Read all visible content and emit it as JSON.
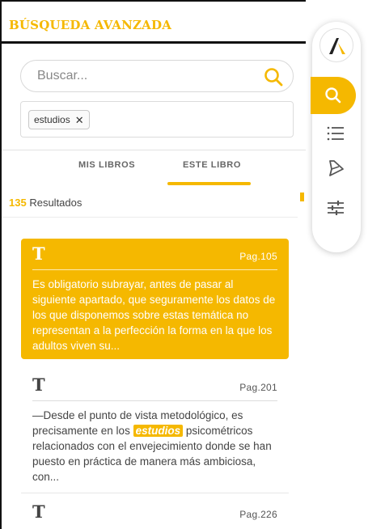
{
  "panel": {
    "title": "BÚSQUEDA AVANZADA",
    "search": {
      "placeholder": "Buscar...",
      "value": ""
    },
    "tags": [
      {
        "label": "estudios"
      }
    ],
    "tabs": [
      {
        "label": "MIS LIBROS",
        "active": false
      },
      {
        "label": "ESTE LIBRO",
        "active": true
      }
    ],
    "results": {
      "count": "135",
      "label": "Resultados"
    },
    "cards": [
      {
        "icon": "T",
        "page": "Pag.105",
        "excerpt": "Es obligatorio subrayar, antes de pasar al siguiente apartado, que seguramente los datos de los que disponemos sobre estas temática no representan a la perfección la forma en la que los adultos viven su...",
        "selected": true
      },
      {
        "icon": "T",
        "page": "Pag.201",
        "excerpt_before": "—Desde el punto de vista metodológico, es precisamente en los",
        "highlight": "estudios",
        "excerpt_after": "psicométricos relacionados con el envejecimiento donde se han puesto en práctica de manera más ambiciosa, con...",
        "selected": false
      },
      {
        "icon": "T",
        "page": "Pag.226",
        "selected": false
      }
    ]
  },
  "toolbar": {
    "items": [
      {
        "icon": "logo-icon"
      },
      {
        "icon": "search-icon",
        "active": true
      },
      {
        "icon": "list-icon"
      },
      {
        "icon": "highlighter-icon"
      },
      {
        "icon": "sliders-icon"
      }
    ]
  },
  "colors": {
    "accent": "#f5b800",
    "text": "#444444",
    "border": "#dcdcdc"
  }
}
